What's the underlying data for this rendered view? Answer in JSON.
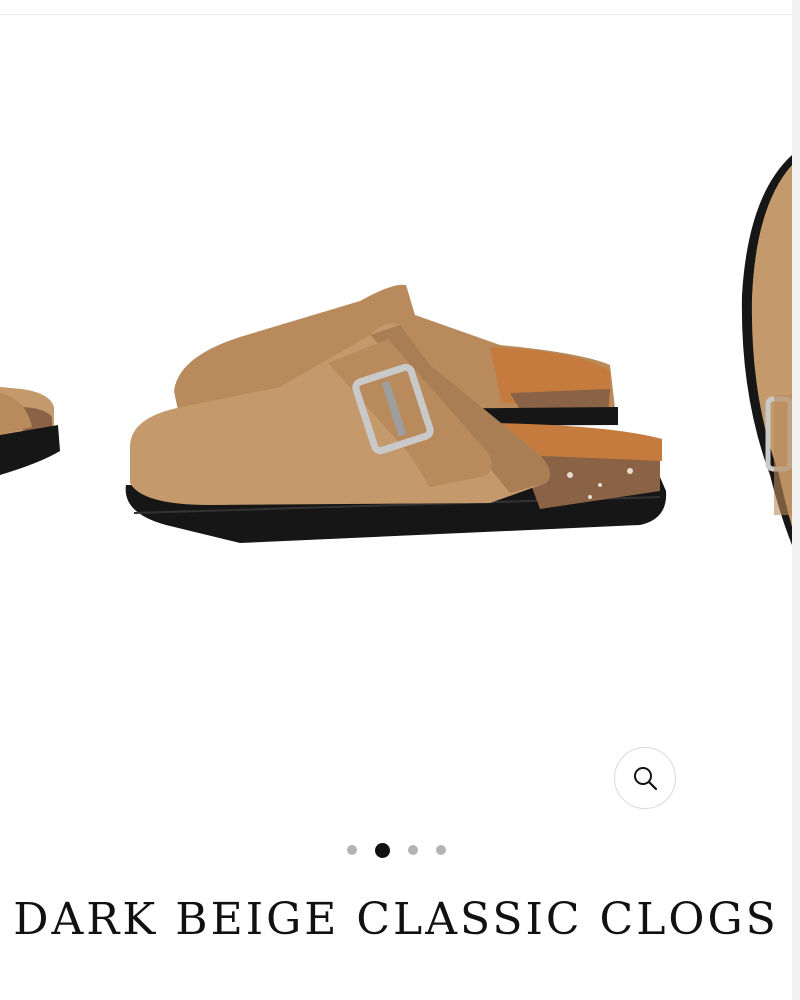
{
  "product": {
    "title": "DARK BEIGE CLASSIC CLOGS"
  },
  "gallery": {
    "slide_count": 4,
    "active_index": 1,
    "zoom_icon": "magnifier-icon"
  },
  "colors": {
    "suede": "#c49a6c",
    "suede_shadow": "#a97e54",
    "sole": "#161616",
    "footbed": "#c67b3e",
    "cork": "#8a6245",
    "buckle": "#c9c9c9"
  }
}
